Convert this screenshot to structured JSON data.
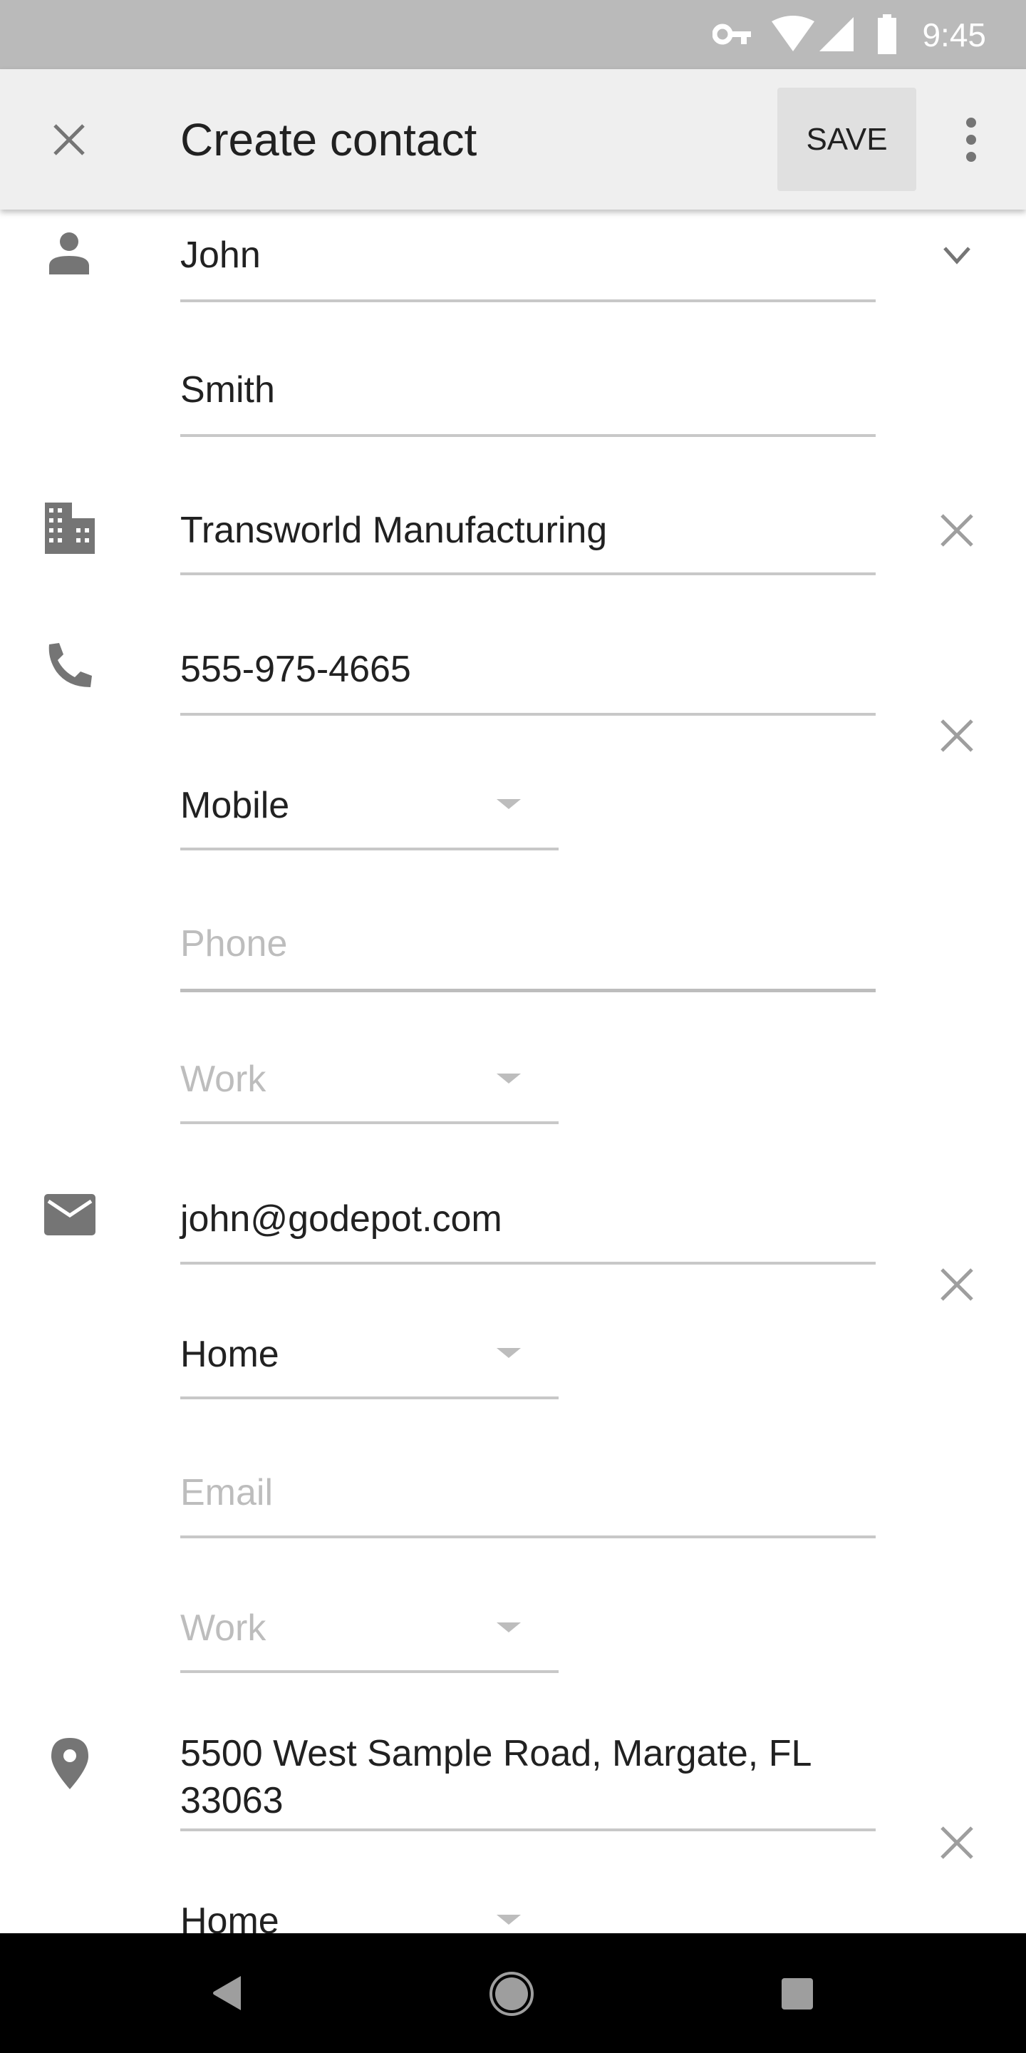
{
  "status_bar": {
    "time": "9:45",
    "icons": [
      "vpn-key-icon",
      "wifi-icon",
      "cell-signal-icon",
      "battery-icon"
    ]
  },
  "app_bar": {
    "close_icon": "close-icon",
    "title": "Create contact",
    "save_label": "SAVE",
    "more_icon": "more-vert-icon"
  },
  "form": {
    "first_name": "John",
    "last_name": "Smith",
    "company": "Transworld Manufacturing",
    "phone": {
      "value": "555-975-4665",
      "type": "Mobile",
      "new_placeholder": "Phone",
      "new_type": "Work"
    },
    "email": {
      "value": "john@godepot.com",
      "type": "Home",
      "new_placeholder": "Email",
      "new_type": "Work"
    },
    "address": {
      "line1": "5500 West Sample Road, Margate, FL",
      "line2": "33063",
      "type": "Home"
    }
  },
  "colors": {
    "status_bar": "#bababa",
    "app_bar": "#efefef",
    "icon": "#757575",
    "underline": "#c8c8c8",
    "placeholder": "#bdbdbd"
  }
}
